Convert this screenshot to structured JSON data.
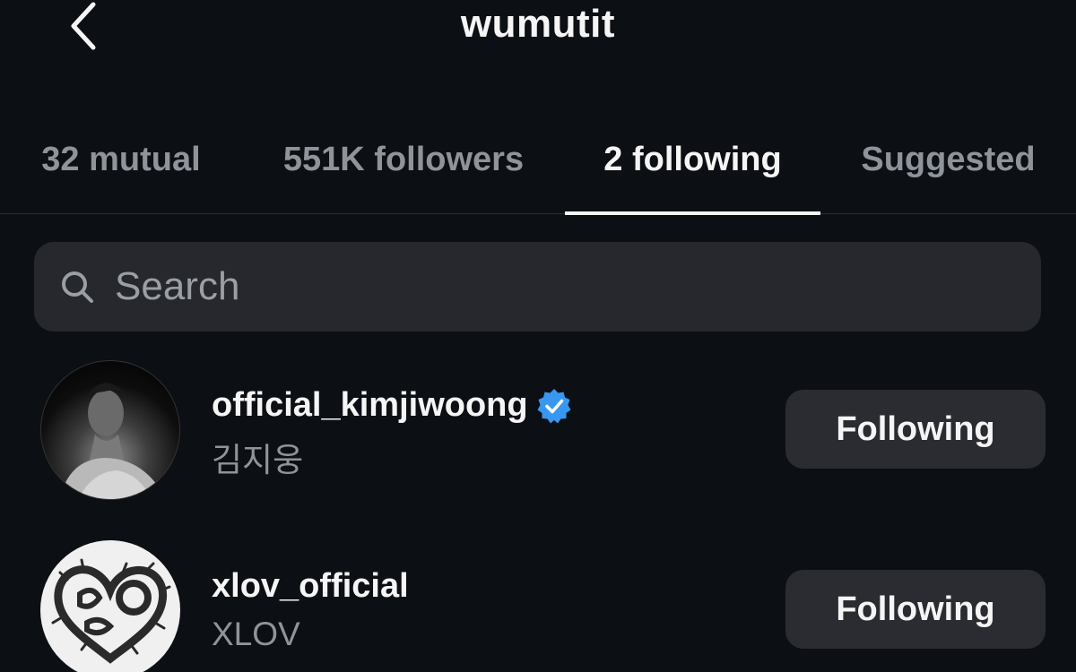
{
  "header": {
    "title": "wumutit"
  },
  "tabs": [
    {
      "label": "32 mutual",
      "active": false
    },
    {
      "label": "551K followers",
      "active": false
    },
    {
      "label": "2 following",
      "active": true
    },
    {
      "label": "Suggested",
      "active": false
    }
  ],
  "search": {
    "placeholder": "Search",
    "value": ""
  },
  "following": [
    {
      "username": "official_kimjiwoong",
      "display_name": "김지웅",
      "verified": true,
      "button_label": "Following"
    },
    {
      "username": "xlov_official",
      "display_name": "XLOV",
      "verified": false,
      "button_label": "Following"
    }
  ],
  "colors": {
    "background": "#0c0f14",
    "search_bg": "#26282d",
    "button_bg": "#2a2c31",
    "muted_text": "#8f949b",
    "verified_blue": "#3897f0"
  },
  "icons": {
    "back": "chevron-left-icon",
    "search": "search-icon",
    "verified": "verified-badge-icon"
  }
}
